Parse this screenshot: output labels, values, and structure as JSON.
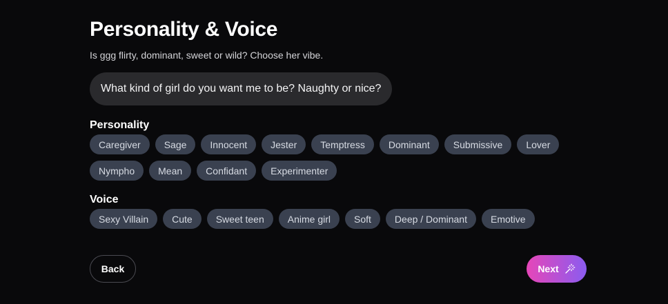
{
  "header": {
    "title": "Personality & Voice",
    "subtitle": "Is ggg flirty, dominant, sweet or wild? Choose her vibe."
  },
  "bubble": {
    "text": "What kind of girl do you want me to be? Naughty or nice?"
  },
  "personality": {
    "label": "Personality",
    "options": [
      "Caregiver",
      "Sage",
      "Innocent",
      "Jester",
      "Temptress",
      "Dominant",
      "Submissive",
      "Lover",
      "Nympho",
      "Mean",
      "Confidant",
      "Experimenter"
    ]
  },
  "voice": {
    "label": "Voice",
    "options": [
      "Sexy Villain",
      "Cute",
      "Sweet teen",
      "Anime girl",
      "Soft",
      "Deep / Dominant",
      "Emotive"
    ]
  },
  "footer": {
    "back_label": "Back",
    "next_label": "Next",
    "next_icon": "magic-wand-icon"
  },
  "colors": {
    "background": "#09090b",
    "chip": "#3a4150",
    "bubble": "#2a2a2d",
    "next_gradient_start": "#e646b8",
    "next_gradient_end": "#8a5cf0"
  }
}
